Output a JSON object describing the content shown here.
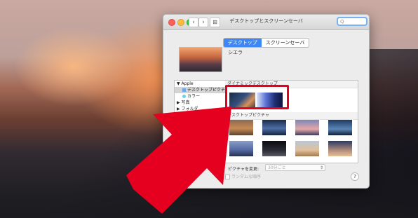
{
  "window": {
    "title": "デスクトップとスクリーンセーバ",
    "nav_back": "‹",
    "nav_forward": "›",
    "grid_icon": "⊞"
  },
  "search": {
    "placeholder": "Q"
  },
  "tabs": [
    {
      "label": "デスクトップ",
      "active": true
    },
    {
      "label": "スクリーンセーバ",
      "active": false
    }
  ],
  "preview": {
    "name": "シエラ"
  },
  "sidebar": {
    "items": [
      {
        "label": "▼ Apple",
        "kind": "group"
      },
      {
        "label": "デスクトップピクチャ",
        "kind": "sub",
        "selected": true
      },
      {
        "label": "カラー",
        "kind": "sub"
      },
      {
        "label": "▶ 写真",
        "kind": "group"
      },
      {
        "label": "▶ フォルダ",
        "kind": "group"
      }
    ]
  },
  "content": {
    "dynamic_header": "ダイナミックデスクトップ",
    "pictures_header": "デスクトップピクチャ"
  },
  "footer": {
    "change_label": "ピクチャを変更:",
    "change_value": "30分ごと",
    "random_label": "ランダムな順序",
    "help": "?"
  },
  "colors": {
    "accent_blue": "#3c86f6",
    "highlight_red": "#e60020"
  }
}
